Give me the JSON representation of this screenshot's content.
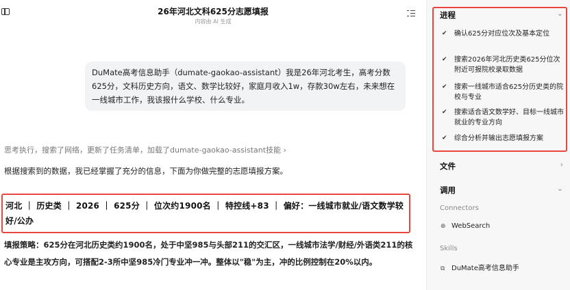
{
  "header": {
    "title": "26年河北文科625分志愿填报",
    "subtitle": "内容由 AI 生成"
  },
  "chat": {
    "user_message": "DuMate高考信息助手（dumate-gaokao-assistant）我是26年河北考生，高考分数625分，文科历史方向，语文、数学比较好，家庭月收入1w，存款30w左右，未来想在一线城市工作，我该报什么学校、什么专业。",
    "process_summary": "思考执行，搜索了网络，更新了任务清单，加载了dumate-gaokao-assistant技能 ›",
    "intro": "根据搜索到的数据，我已经掌握了充分的信息，下面为你做完整的志愿填报方案。",
    "info_line": "河北 ｜ 历史类 ｜ 2026 ｜ 625分 ｜ 位次约1900名 ｜ 特控线+83 ｜ 偏好：一线城市就业/语文数学较好/公办",
    "strategy": "填报策略：625分在河北历史类约1900名，处于中坚985与头部211的交汇区，一线城市法学/财经/外语类211的核心专业是主攻方向，可搭配2-3所中坚985冷门专业冲一冲。整体以\"稳\"为主，冲的比例控制在20%以内。"
  },
  "sidebar": {
    "progress": {
      "label": "进程",
      "tasks": [
        "确认625分对应位次及基本定位",
        "搜索2026年河北历史类625分位次附近可报院校录取数据",
        "搜索一线城市适合625分历史类的院校与专业",
        "搜索适合语文数学好、目标一线城市就业的专业方向",
        "综合分析并输出志愿填报方案"
      ]
    },
    "files": {
      "label": "文件"
    },
    "calls": {
      "label": "调用",
      "connectors_label": "Connectors",
      "connector": "WebSearch",
      "skills_label": "Skills",
      "skill": "DuMate高考信息助手"
    }
  }
}
